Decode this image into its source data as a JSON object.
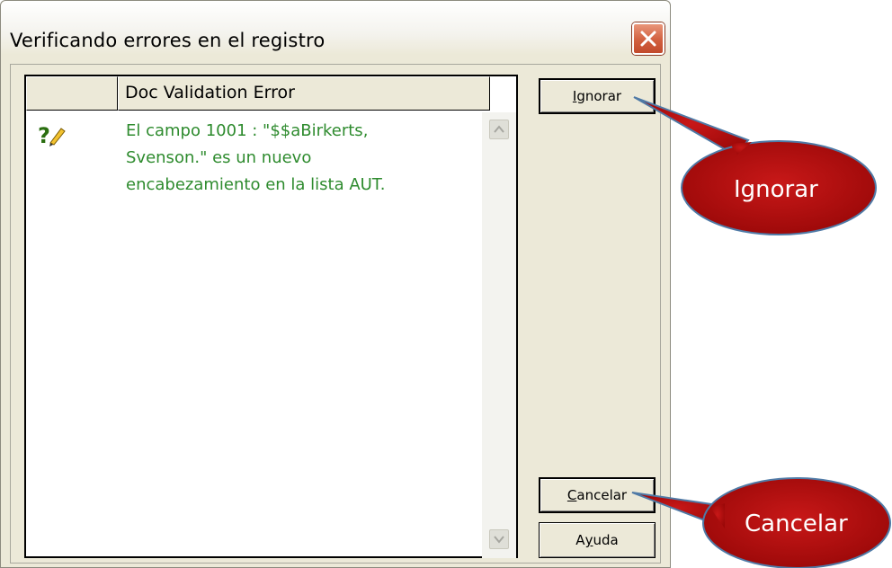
{
  "window": {
    "title": "Verificando errores en el registro"
  },
  "list": {
    "column_header": "Doc Validation Error",
    "rows": [
      {
        "icon": "question-pencil-icon",
        "lines": [
          "El campo 1001 : \"$$aBirkerts,",
          "Svenson.\" es un nuevo",
          "encabezamiento en la lista AUT."
        ]
      }
    ]
  },
  "buttons": {
    "ignore": {
      "label": "Ignorar",
      "mnemonic": "I",
      "rest": "gnorar"
    },
    "cancel": {
      "label": "Cancelar",
      "mnemonic": "C",
      "rest": "ancelar"
    },
    "help": {
      "label": "Ayuda",
      "pre": "A",
      "mnemonic": "y",
      "rest": "uda"
    }
  },
  "callouts": {
    "ignore": "Ignorar",
    "cancel": "Cancelar"
  },
  "colors": {
    "callout_fill": "#b80d0d",
    "row_text": "#2e8b2e",
    "close_button": "#d2603f"
  }
}
